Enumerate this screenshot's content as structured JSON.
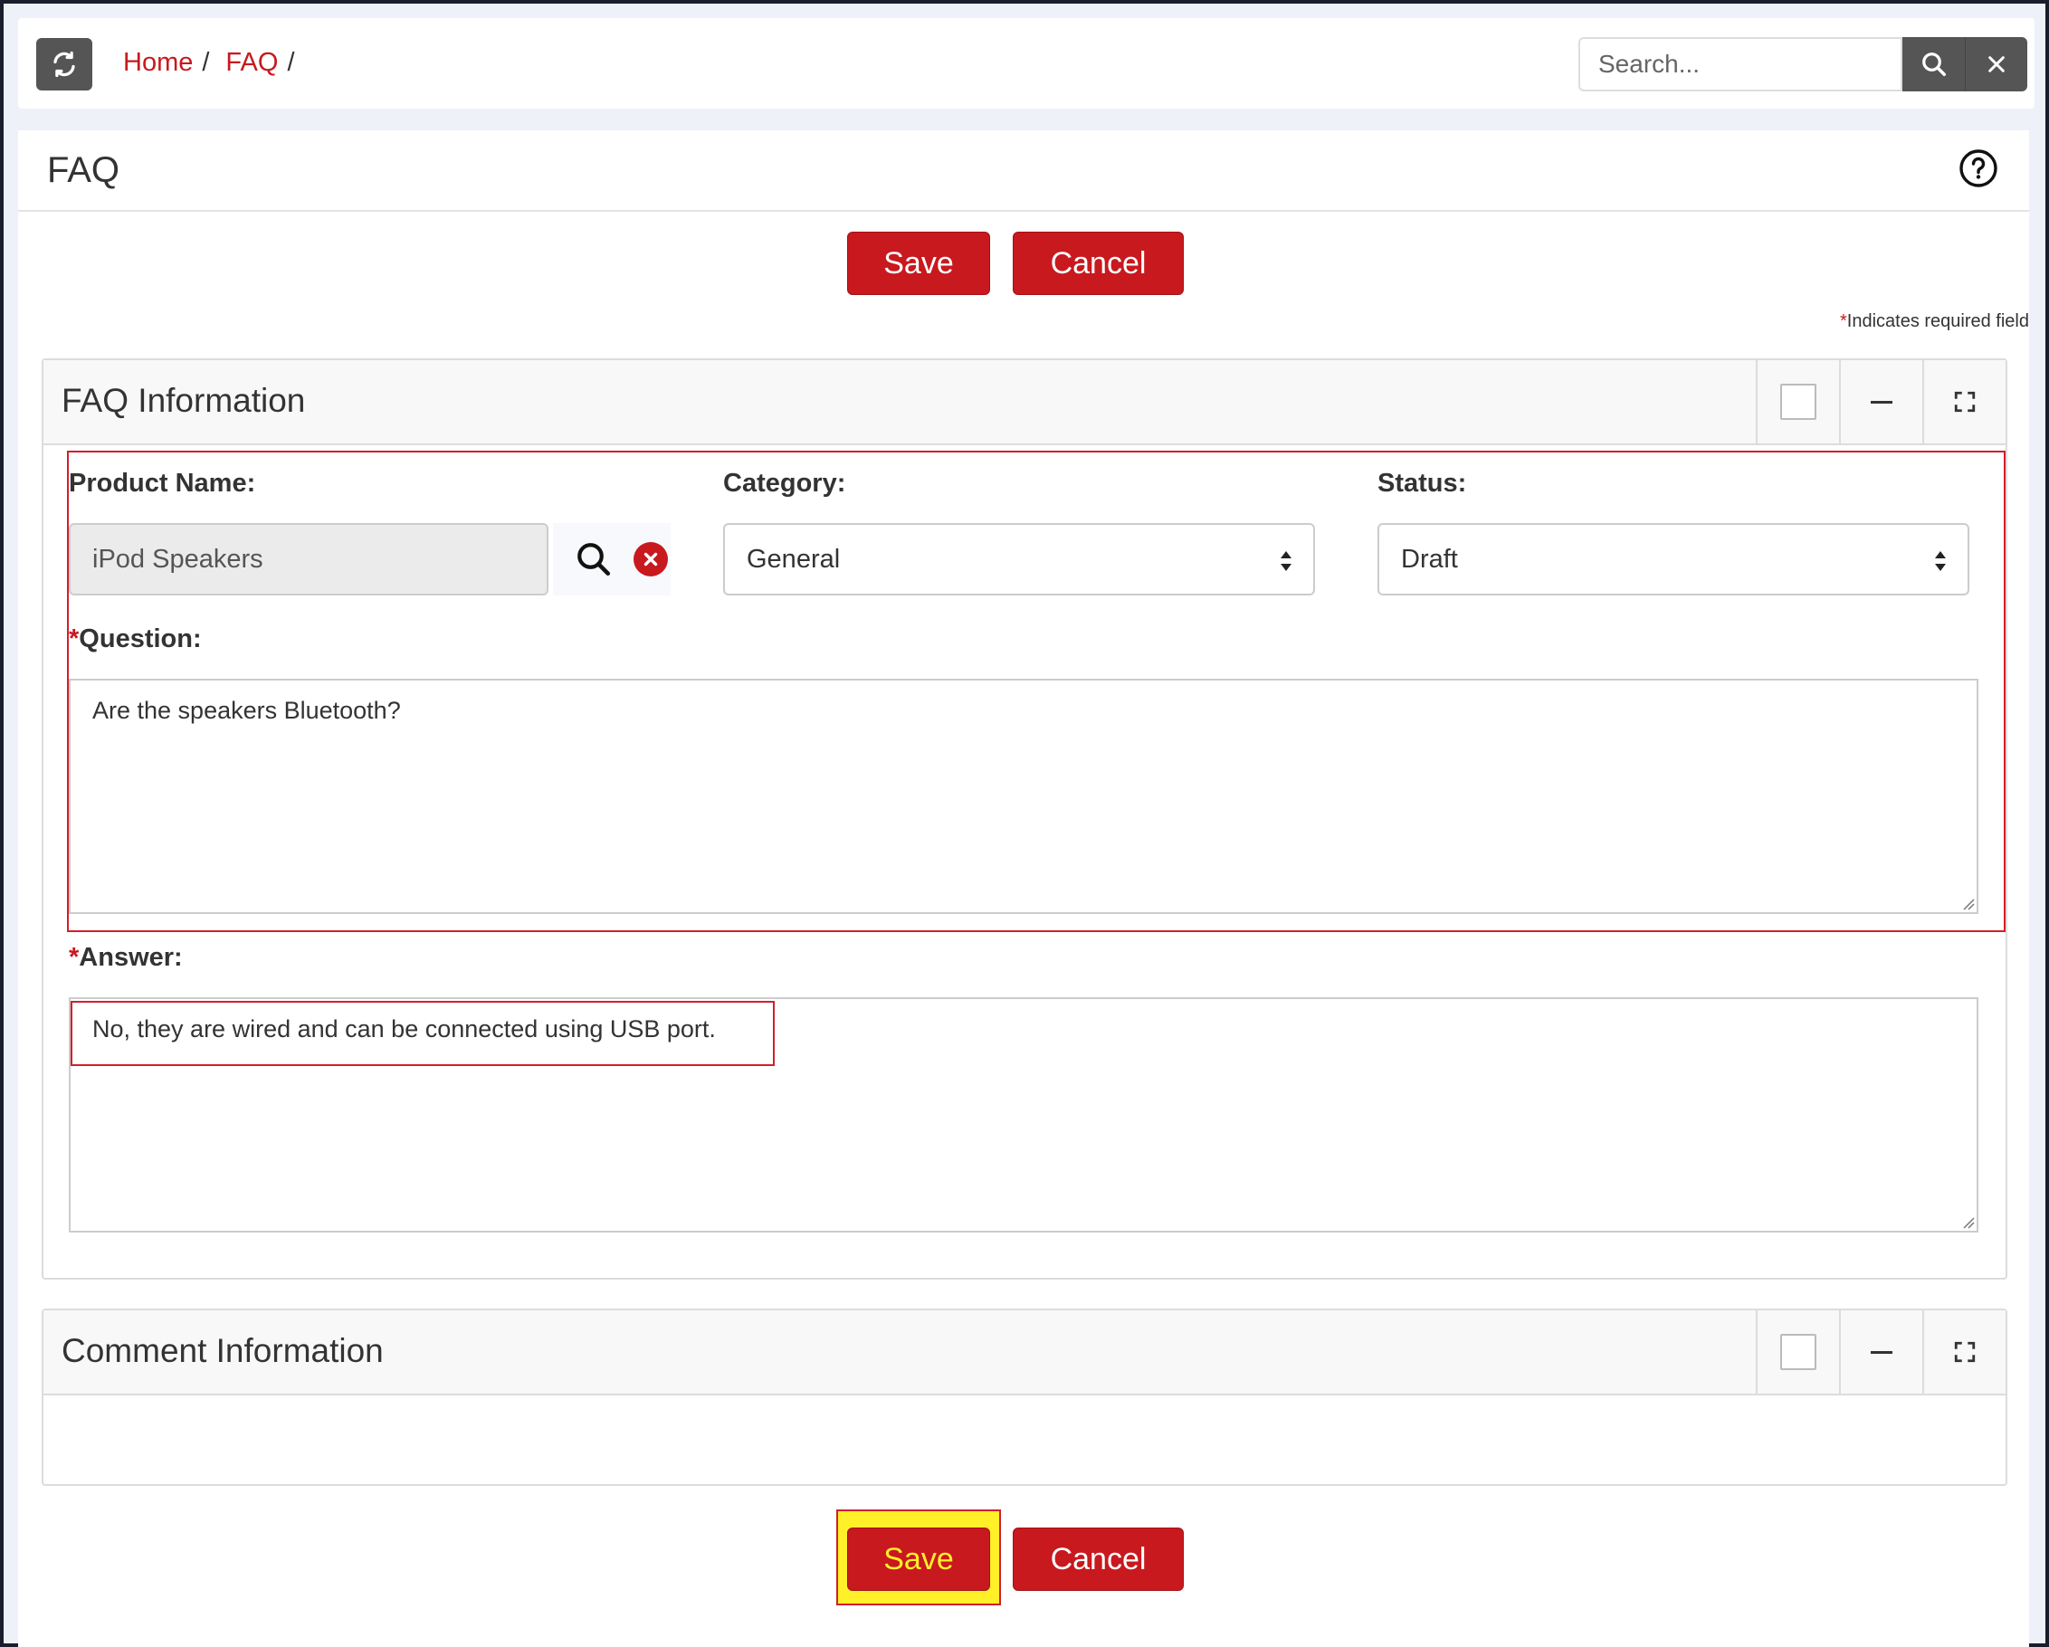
{
  "topbar": {
    "refresh_icon": "refresh-icon",
    "breadcrumb": [
      {
        "label": "Home"
      },
      {
        "label": "FAQ"
      }
    ],
    "breadcrumb_sep": "/",
    "search_placeholder": "Search...",
    "search_icon": "search-icon",
    "clear_icon": "close-icon"
  },
  "page": {
    "title": "FAQ",
    "help_icon": "question-circle-icon",
    "save_label": "Save",
    "cancel_label": "Cancel",
    "required_star": "*",
    "required_note": "Indicates required field"
  },
  "faq_panel": {
    "title": "FAQ Information",
    "product_label": "Product Name:",
    "product_value": "iPod Speakers",
    "category_label": "Category:",
    "category_value": "General",
    "status_label": "Status:",
    "status_value": "Draft",
    "question_label": "Question:",
    "question_value": "Are the speakers Bluetooth?",
    "answer_label": "Answer:",
    "answer_value": "No, they are wired and can be connected using USB port.",
    "required_star": "*"
  },
  "comment_panel": {
    "title": "Comment Information"
  },
  "colors": {
    "accent": "#c8191e",
    "highlight": "#fff02a",
    "annotation_box": "#d21f2b"
  }
}
